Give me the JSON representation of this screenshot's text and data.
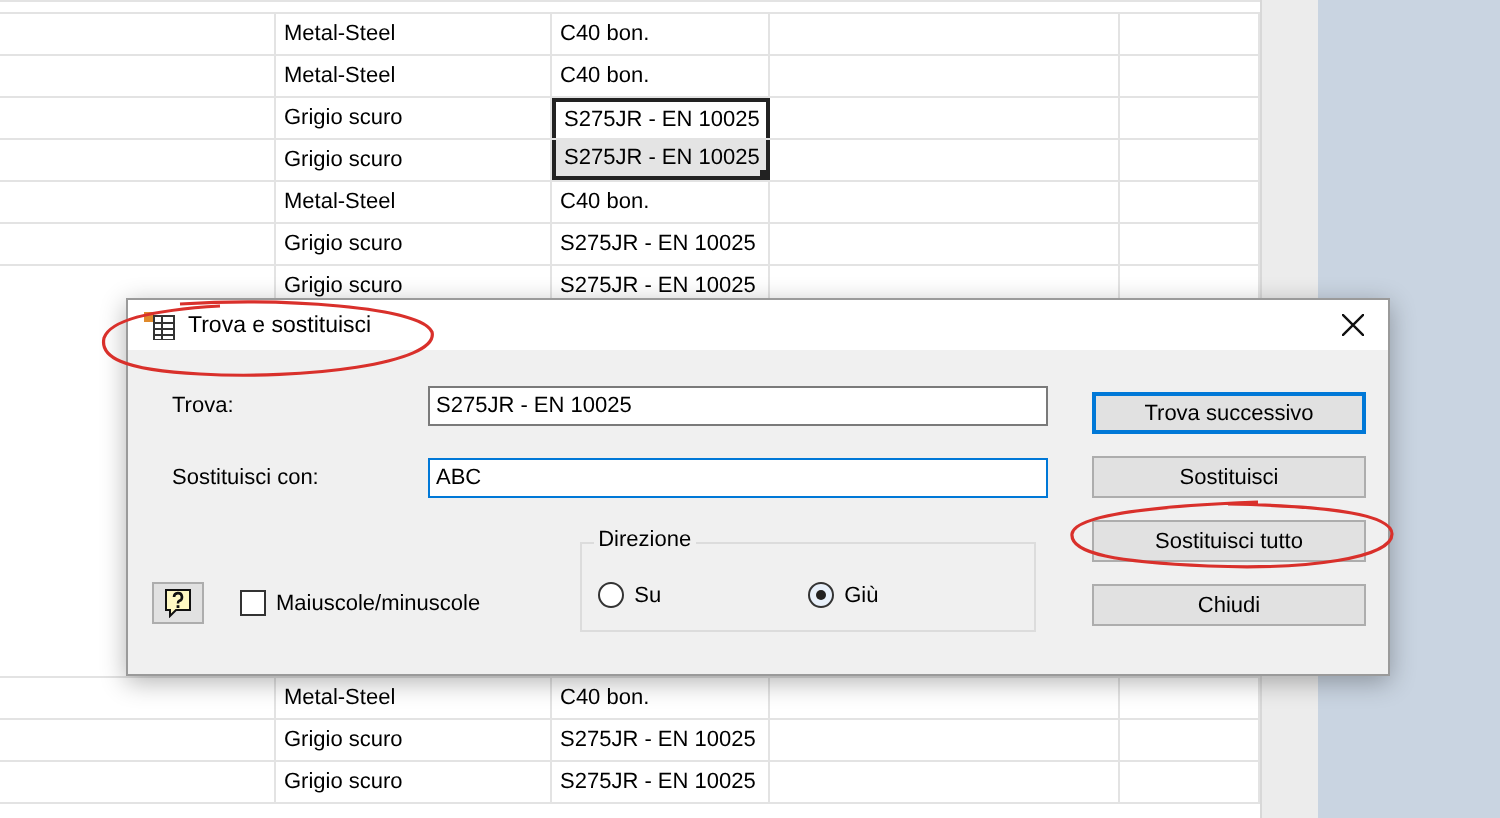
{
  "sheet": {
    "rows_top": [
      {
        "col_2": "Metal-Steel",
        "col_3": "C40 bon.",
        "selected": false
      },
      {
        "col_2": "Metal-Steel",
        "col_3": "C40 bon.",
        "selected": false
      },
      {
        "col_2": "Grigio scuro",
        "col_3": "S275JR - EN 10025",
        "selected": true
      },
      {
        "col_2": "Grigio scuro",
        "col_3": "S275JR - EN 10025",
        "selected": true
      },
      {
        "col_2": "Metal-Steel",
        "col_3": "C40 bon.",
        "selected": false
      },
      {
        "col_2": "Grigio scuro",
        "col_3": "S275JR - EN 10025",
        "selected": false
      },
      {
        "col_2": "Grigio scuro",
        "col_3": "S275JR - EN 10025",
        "selected": false
      }
    ],
    "rows_bottom": [
      {
        "col_2": "Metal-Steel",
        "col_3": "C40 bon.",
        "selected": false
      },
      {
        "col_2": "Grigio scuro",
        "col_3": "S275JR - EN 10025",
        "selected": false
      },
      {
        "col_2": "Grigio scuro",
        "col_3": "S275JR - EN 10025",
        "selected": false
      }
    ]
  },
  "dialog": {
    "title": "Trova e sostituisci",
    "fields": [
      {
        "label": "Trova:",
        "value": "S275JR - EN 10025",
        "focused": false
      },
      {
        "label": "Sostituisci con:",
        "value": "ABC",
        "focused": true
      }
    ],
    "match_case": {
      "label": "Maiuscole/minuscole",
      "checked": false
    },
    "direction": {
      "title": "Direzione",
      "options": [
        {
          "label": "Su",
          "selected": false
        },
        {
          "label": "Giù",
          "selected": true
        }
      ]
    },
    "buttons": [
      {
        "label": "Trova successivo",
        "default": true
      },
      {
        "label": "Sostituisci",
        "default": false
      },
      {
        "label": "Sostituisci tutto",
        "default": false
      },
      {
        "label": "Chiudi",
        "default": false
      }
    ]
  }
}
